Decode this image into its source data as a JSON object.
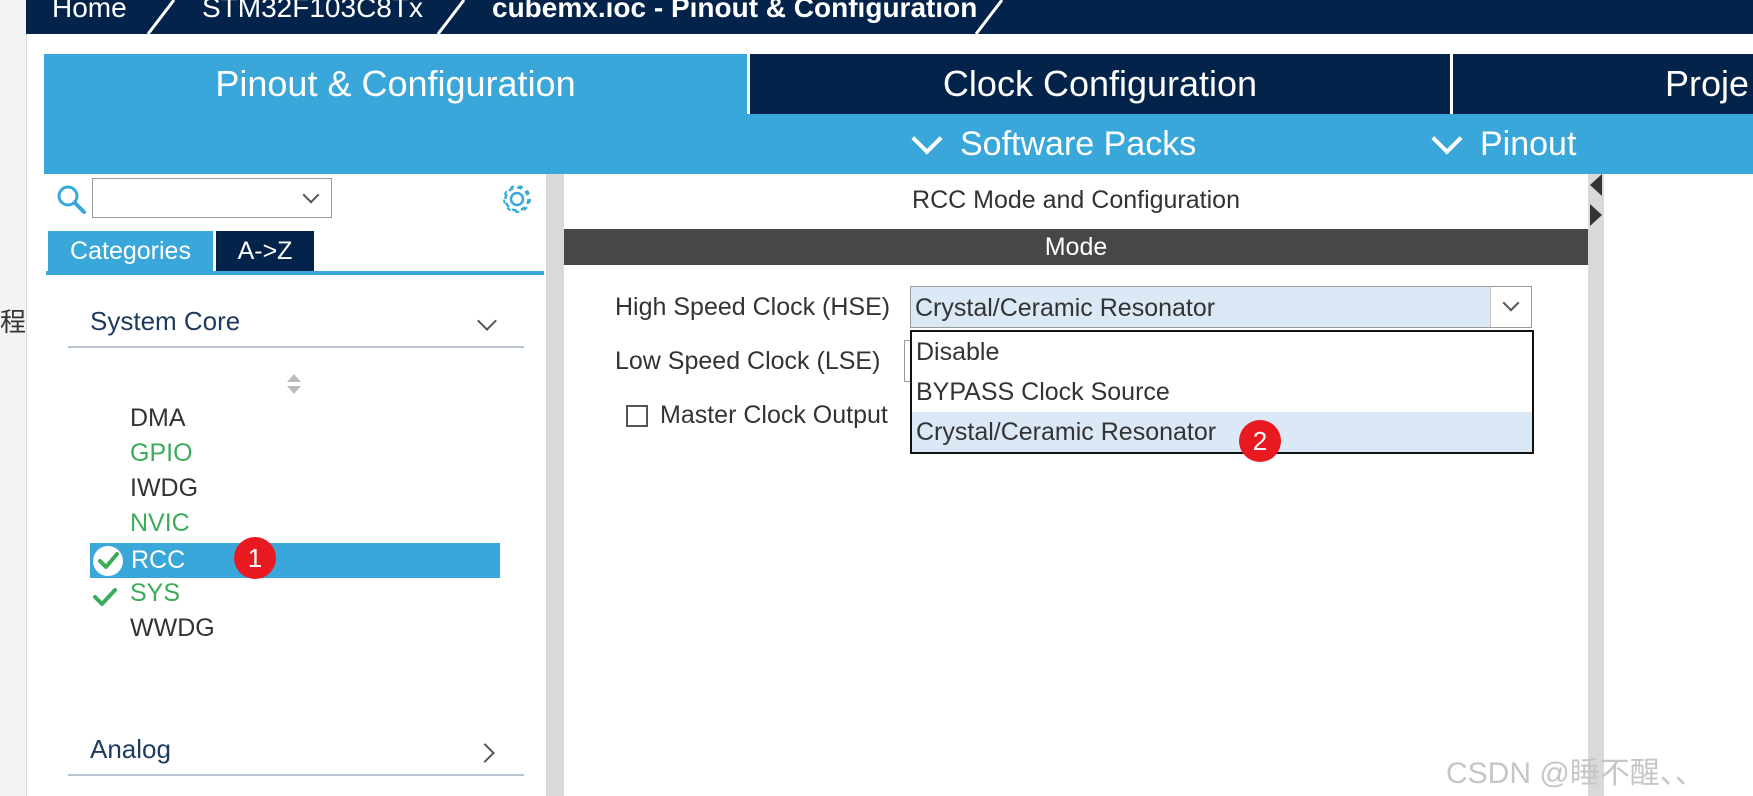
{
  "breadcrumb": {
    "items": [
      "Home",
      "STM32F103C8Tx",
      "cubemx.ioc - Pinout & Configuration"
    ]
  },
  "tabs": {
    "pinout": "Pinout & Configuration",
    "clock": "Clock Configuration",
    "project": "Proje"
  },
  "subbar": {
    "software_packs": "Software Packs",
    "pinout": "Pinout"
  },
  "left_panel": {
    "search": {
      "value": ""
    },
    "tab_categories": "Categories",
    "tab_az": "A->Z",
    "section_system_core": "System Core",
    "section_analog": "Analog",
    "items": [
      "DMA",
      "GPIO",
      "IWDG",
      "NVIC",
      "RCC",
      "SYS",
      "WWDG"
    ]
  },
  "right_panel": {
    "title": "RCC Mode and Configuration",
    "mode_header": "Mode",
    "hse_label": "High Speed Clock (HSE)",
    "hse_value": "Crystal/Ceramic Resonator",
    "lse_label": "Low Speed Clock (LSE)",
    "mco_label": "Master Clock Output",
    "dropdown_options": [
      "Disable",
      "BYPASS Clock Source",
      "Crystal/Ceramic Resonator"
    ]
  },
  "annotations": {
    "badge_1": "1",
    "badge_2": "2"
  },
  "left_edge_char": "程",
  "watermark": "CSDN @睡不醒、、",
  "colors": {
    "navy": "#03234b",
    "blue": "#3aa7db",
    "green": "#3cab5a",
    "badge_red": "#e8191f",
    "mode_bar": "#474747",
    "select_bg": "#dbe8f5"
  }
}
